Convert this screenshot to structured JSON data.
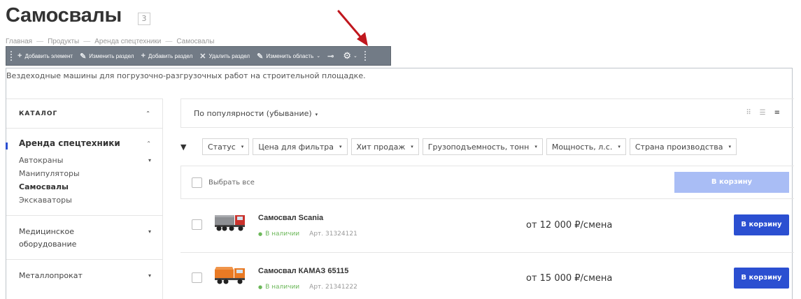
{
  "page": {
    "title": "Самосвалы",
    "count": "3",
    "description": "Вездеходные машины для погрузочно-разгрузочных работ на строительной площадке."
  },
  "breadcrumb": [
    "Главная",
    "Продукты",
    "Аренда спецтехники",
    "Самосвалы"
  ],
  "admin_bar": {
    "add_element": "Добавить элемент",
    "edit_section": "Изменить раздел",
    "add_section": "Добавить раздел",
    "delete_section": "Удалить раздел",
    "edit_area": "Изменить область"
  },
  "sidebar": {
    "header": "КАТАЛОГ",
    "active_section": "Аренда спецтехники",
    "sub_items": [
      "Автокраны",
      "Манипуляторы",
      "Самосвалы",
      "Экскаваторы"
    ],
    "groups": [
      "Медицинское оборудование",
      "Металлопрокат"
    ]
  },
  "sort": {
    "label": "По популярности (убывание)"
  },
  "filters": [
    "Статус",
    "Цена для фильтра",
    "Хит продаж",
    "Грузоподъемность, тонн",
    "Мощность, л.с.",
    "Страна производства"
  ],
  "list": {
    "select_all": "Выбрать все",
    "cart_all": "В корзину"
  },
  "products": [
    {
      "name": "Самосвал Scania",
      "stock": "В наличии",
      "article": "Арт. 31324121",
      "price": "от 12 000 ₽/смена",
      "cart": "В корзину",
      "color": "#8d8f93"
    },
    {
      "name": "Самосвал КАМАЗ 65115",
      "stock": "В наличии",
      "article": "Арт. 21341222",
      "price": "от 15 000 ₽/смена",
      "cart": "В корзину",
      "color": "#e97a24"
    }
  ],
  "colors": {
    "accent": "#2b4fd1",
    "accent_disabled": "#a9bdf5",
    "in_stock": "#6cb85a",
    "arrow": "#c0171e"
  }
}
